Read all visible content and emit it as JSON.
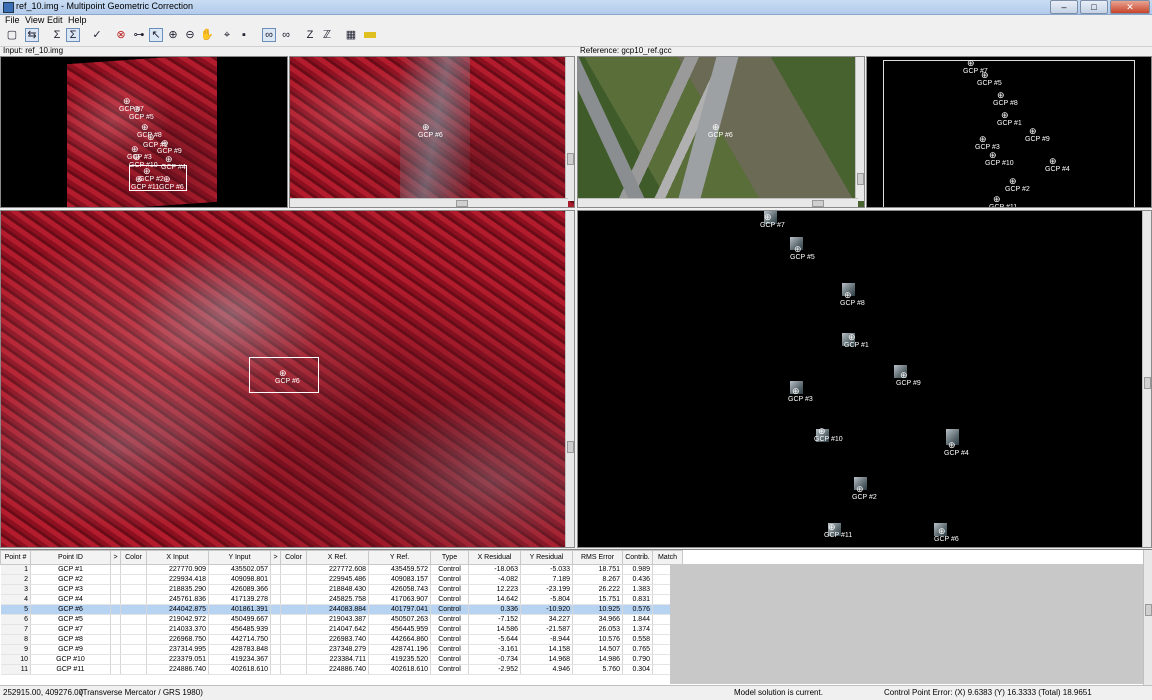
{
  "window": {
    "title": "ref_10.img - Multipoint Geometric Correction"
  },
  "menu": [
    "File",
    "View",
    "Edit",
    "Help"
  ],
  "toolbar": {
    "icons": [
      "new-icon",
      "sync-icon",
      "sigma-icon",
      "sigma-list-icon",
      "check-icon",
      "target-icon",
      "link-icon",
      "select-arrow-icon",
      "zoom-in-icon",
      "zoom-out-icon",
      "pan-hand-icon",
      "crosshair-icon",
      "lock-icon",
      "binoculars-icon",
      "binoculars-2-icon",
      "z-icon",
      "zz-icon",
      "grid-icon",
      "ruler-icon"
    ]
  },
  "panels": {
    "input_label": "Input: ref_10.img",
    "reference_label": "Reference: gcp10_ref.gcc"
  },
  "gcp_labels": {
    "overview": [
      "GCP #7",
      "GCP #5",
      "GCP #8",
      "GCP #1",
      "GCP #3",
      "GCP #9",
      "GCP #10",
      "GCP #4",
      "GCP #2",
      "GCP #11",
      "GCP #6"
    ],
    "focus": "GCP #6",
    "ref_overview": [
      "GCP #7",
      "GCP #5",
      "GCP #8",
      "GCP #1",
      "GCP #3",
      "GCP #9",
      "GCP #10",
      "GCP #4",
      "GCP #2",
      "GCP #11"
    ],
    "ref_chips": [
      "GCP #7",
      "GCP #5",
      "GCP #8",
      "GCP #1",
      "GCP #9",
      "GCP #3",
      "GCP #10",
      "GCP #4",
      "GCP #2",
      "GCP #11",
      "GCP #6"
    ]
  },
  "table": {
    "columns": [
      "Point #",
      "Point ID",
      ">",
      "Color",
      "X Input",
      "Y Input",
      ">",
      "Color",
      "X Ref.",
      "Y Ref.",
      "Type",
      "X Residual",
      "Y Residual",
      "RMS Error",
      "Contrib.",
      "Match"
    ],
    "rows": [
      [
        "1",
        "GCP #1",
        "",
        "",
        "227770.909",
        "435502.057",
        "",
        "",
        "227772.608",
        "435459.572",
        "Control",
        "-18.063",
        "-5.033",
        "18.751",
        "0.989",
        ""
      ],
      [
        "2",
        "GCP #2",
        "",
        "",
        "229934.418",
        "409098.801",
        "",
        "",
        "229945.486",
        "409083.157",
        "Control",
        "-4.082",
        "7.189",
        "8.267",
        "0.436",
        ""
      ],
      [
        "3",
        "GCP #3",
        "",
        "",
        "218835.290",
        "426089.366",
        "",
        "",
        "218848.430",
        "426058.743",
        "Control",
        "12.223",
        "-23.199",
        "26.222",
        "1.383",
        ""
      ],
      [
        "4",
        "GCP #4",
        "",
        "",
        "245761.836",
        "417139.278",
        "",
        "",
        "245825.758",
        "417063.907",
        "Control",
        "14.642",
        "-5.804",
        "15.751",
        "0.831",
        ""
      ],
      [
        "5",
        "GCP #6",
        "",
        "",
        "244042.875",
        "401861.391",
        "",
        "",
        "244083.884",
        "401797.041",
        "Control",
        "0.336",
        "-10.920",
        "10.925",
        "0.576",
        ""
      ],
      [
        "6",
        "GCP #5",
        "",
        "",
        "219042.972",
        "450499.667",
        "",
        "",
        "219043.387",
        "450507.263",
        "Control",
        "-7.152",
        "34.227",
        "34.966",
        "1.844",
        ""
      ],
      [
        "7",
        "GCP #7",
        "",
        "",
        "214033.370",
        "456485.939",
        "",
        "",
        "214047.642",
        "456445.959",
        "Control",
        "14.586",
        "-21.587",
        "26.053",
        "1.374",
        ""
      ],
      [
        "8",
        "GCP #8",
        "",
        "",
        "226968.750",
        "442714.750",
        "",
        "",
        "226983.740",
        "442664.860",
        "Control",
        "-5.644",
        "-8.944",
        "10.576",
        "0.558",
        ""
      ],
      [
        "9",
        "GCP #9",
        "",
        "",
        "237314.995",
        "428783.848",
        "",
        "",
        "237348.279",
        "428741.196",
        "Control",
        "-3.161",
        "14.158",
        "14.507",
        "0.765",
        ""
      ],
      [
        "10",
        "GCP #10",
        "",
        "",
        "223379.051",
        "419234.367",
        "",
        "",
        "223384.711",
        "419235.520",
        "Control",
        "-0.734",
        "14.968",
        "14.986",
        "0.790",
        ""
      ],
      [
        "11",
        "GCP #11",
        "",
        "",
        "224886.740",
        "402618.610",
        "",
        "",
        "224886.740",
        "402618.610",
        "Control",
        "-2.952",
        "4.946",
        "5.760",
        "0.304",
        ""
      ]
    ],
    "selected_row": 4
  },
  "status": {
    "coords": "252915.00, 409276.00",
    "projection": "(Transverse Mercator / GRS 1980)",
    "model": "Model solution is current.",
    "error": "Control Point Error: (X) 9.6383     (Y) 16.3333     (Total) 18.9651"
  }
}
